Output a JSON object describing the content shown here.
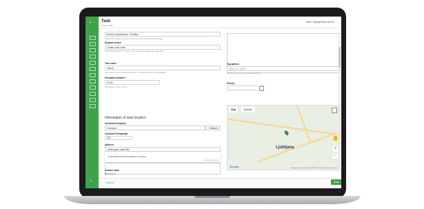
{
  "header": {
    "title": "Task",
    "breadcrumb": "Home / Task",
    "user": "Hello, MightyFields Admin"
  },
  "form": {
    "template_value": "Device maintenance - Printing",
    "template_hint": "Select from template you wish to use. You cannot change this value later.",
    "dispatch_label": "Dispatch action",
    "dispatch_hint": "Select dispatch action you wish to use. You cannot change this value later.",
    "dispatch_value": "Create work order",
    "task_name_label": "Task name *",
    "task_name_value": "Task 6",
    "task_name_hint": "Task name is used to display information on mobile device or web application.",
    "duration_label": "Estimated duration *",
    "duration_value": "01:00",
    "duration_hint": "Set duration of task in hours",
    "tag_label": "Tag options",
    "tag_placeholder": "Select an option",
    "tag_hint": "Use tags to filter through unassigned tasks",
    "priority_label": "Priority",
    "section_title": "Information of task location",
    "customer_label": "Customer/Company",
    "customer_value": "Comland",
    "search_button": "Search",
    "customer_id_label": "Customer/CompanyId",
    "customer_id_value": "201",
    "address_label": "Address",
    "address_value": "Litostrojska cesta 58c",
    "suggestion": "Litostrojska Cesta 40c Ljubljana, Slovenia",
    "powered_by": "powered by Google",
    "contact_label": "Contact name",
    "contact_value": "Marko Zupan"
  },
  "map": {
    "tab_map": "Map",
    "tab_satellite": "Satellite",
    "city": "Ljubljana",
    "logo": "Google",
    "footer": "Keyboard shortcuts   Map data ©2023   Terms of Use   Report a map error"
  },
  "footer": {
    "cancel": "Cancel",
    "save": "Save"
  },
  "colors": {
    "accent": "#3ea24a"
  },
  "icons": {
    "back": "chevron-left-icon",
    "forward": "chevron-right-icon"
  }
}
